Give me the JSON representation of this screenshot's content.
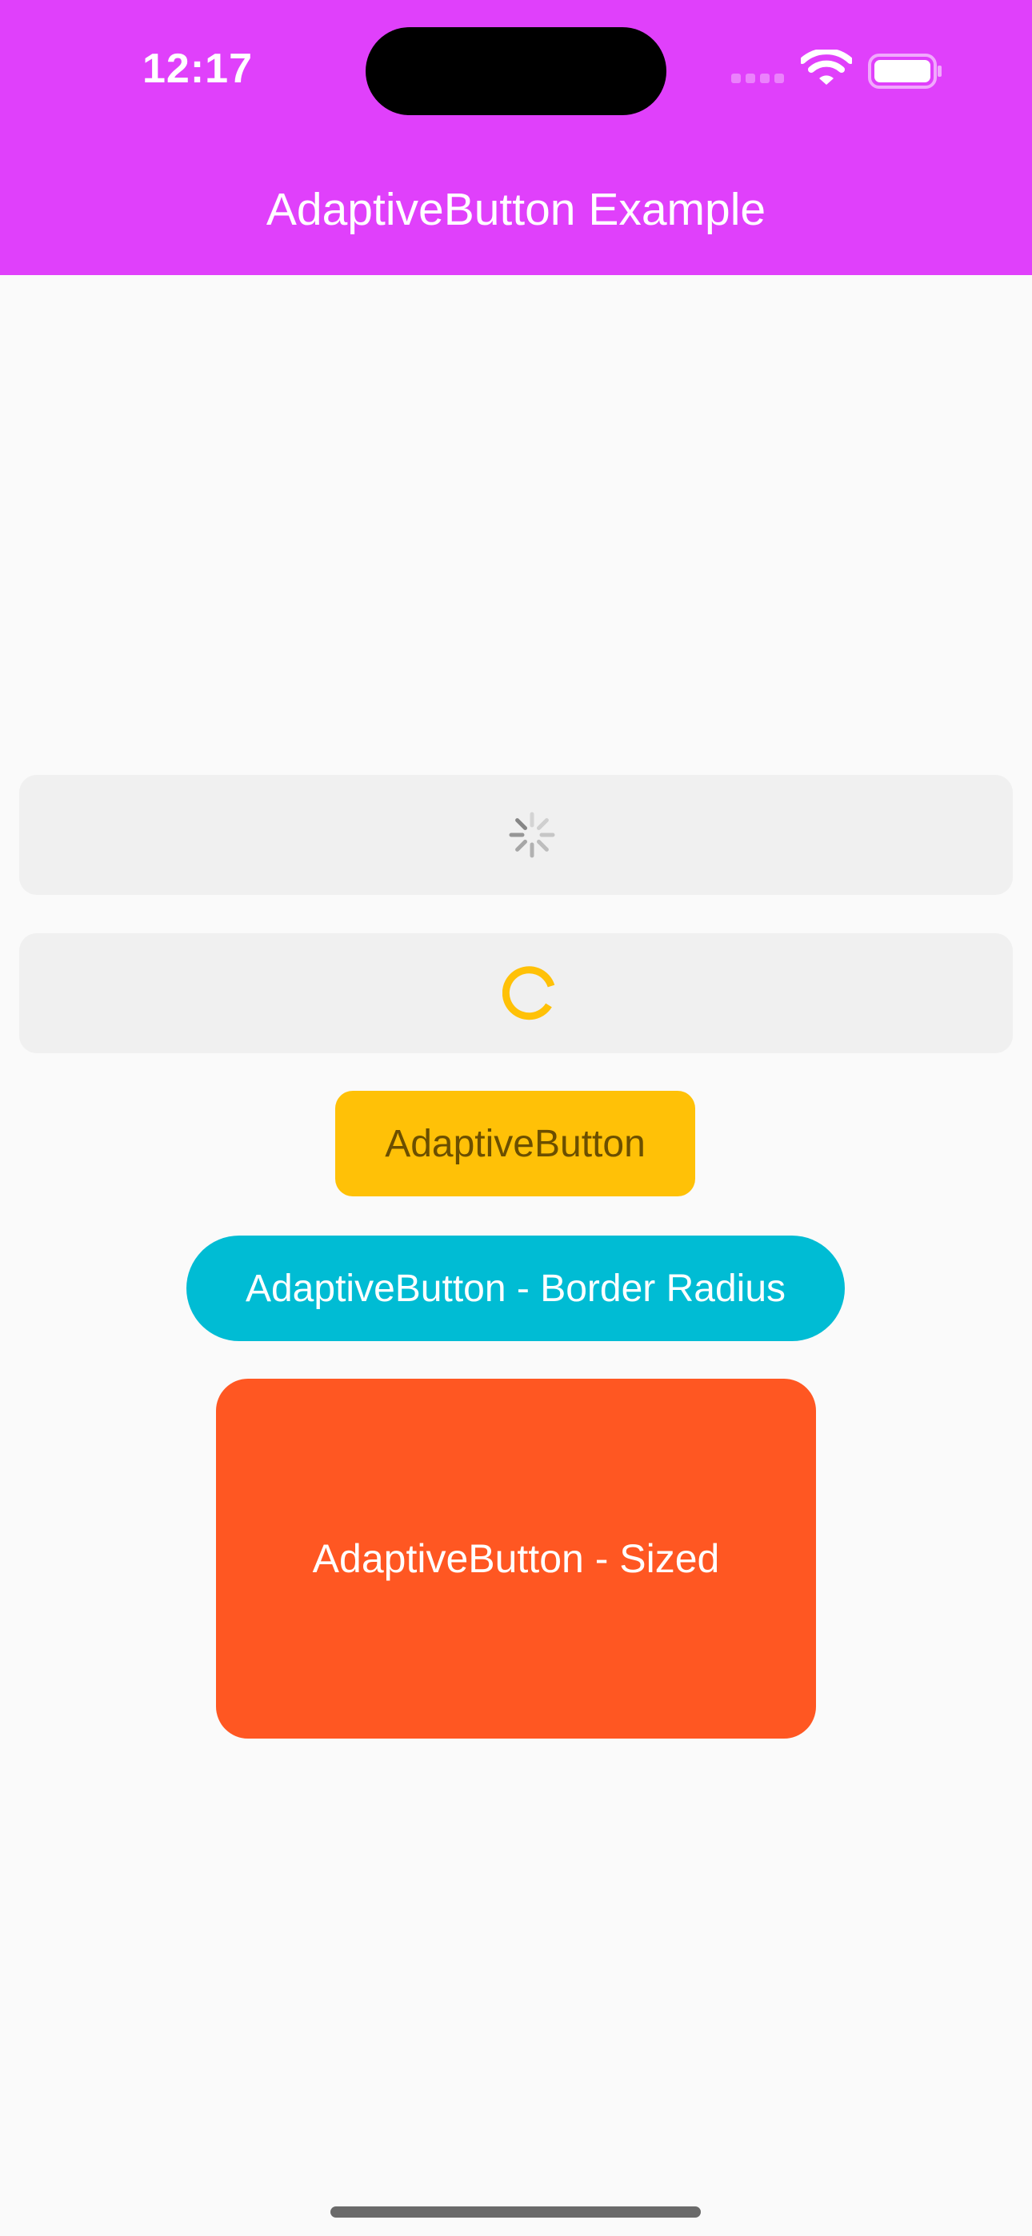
{
  "status_bar": {
    "time": "12:17",
    "icons": [
      "cellular-signal-icon",
      "wifi-icon",
      "battery-icon"
    ]
  },
  "app_bar": {
    "title": "AdaptiveButton Example",
    "background": "#e040fb"
  },
  "buttons": {
    "loading_cupertino": {
      "state": "loading",
      "indicator": "cupertino-activity-indicator",
      "background": "#f0f0f0"
    },
    "loading_material": {
      "state": "loading",
      "indicator": "circular-progress-indicator",
      "indicator_color": "#ffc107",
      "background": "#f0f0f0"
    },
    "default": {
      "label": "AdaptiveButton",
      "background": "#ffc107"
    },
    "border_radius": {
      "label": "AdaptiveButton - Border Radius",
      "background": "#00bcd4"
    },
    "sized": {
      "label": "AdaptiveButton - Sized",
      "background": "#ff5722"
    }
  }
}
